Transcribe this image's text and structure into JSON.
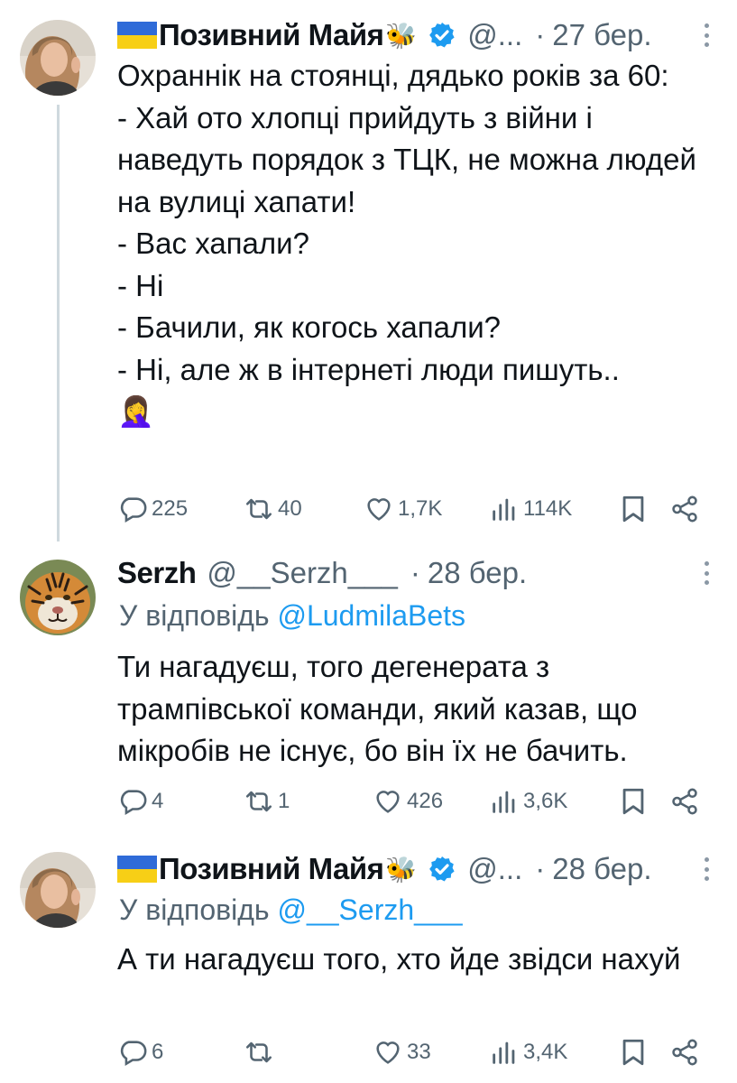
{
  "tweets": [
    {
      "author": "Позивний Майя",
      "author_emoji": "🐝",
      "flag": "ukraine-flag",
      "verified": true,
      "handle": "@...",
      "date": "27 бер.",
      "reply_to": null,
      "text": "Охраннік на стоянці, дядько років за 60:\n- Хай ото хлопці прийдуть з війни і наведуть порядок з ТЦК, не можна людей на вулиці хапати!\n- Вас хапали?\n- Ні\n- Бачили, як когось хапали?\n- Ні, але ж в інтернеті люди пишуть..\n🤦‍♀️",
      "stats": {
        "replies": "225",
        "retweets": "40",
        "likes": "1,7K",
        "views": "114K"
      }
    },
    {
      "author": "Serzh",
      "handle": "@__Serzh___",
      "date": "28 бер.",
      "reply_prefix": "У відповідь",
      "reply_to": "@LudmilaBets",
      "text": "Ти нагадуєш, того дегенерата з трампівської команди, який казав, що мікробів не існує, бо він їх не бачить.",
      "stats": {
        "replies": "4",
        "retweets": "1",
        "likes": "426",
        "views": "3,6K"
      }
    },
    {
      "author": "Позивний Майя",
      "author_emoji": "🐝",
      "flag": "ukraine-flag",
      "verified": true,
      "handle": "@...",
      "date": "28 бер.",
      "reply_prefix": "У відповідь",
      "reply_to": "@__Serzh___",
      "text": "А ти нагадуєш того, хто йде звідси нахуй",
      "stats": {
        "replies": "6",
        "retweets": "",
        "likes": "33",
        "views": "3,4K"
      }
    }
  ],
  "colors": {
    "text": "#0f1419",
    "secondary": "#536471",
    "link": "#1d9bf0",
    "verified": "#1d9bf0",
    "thread_line": "#cfd9de"
  }
}
